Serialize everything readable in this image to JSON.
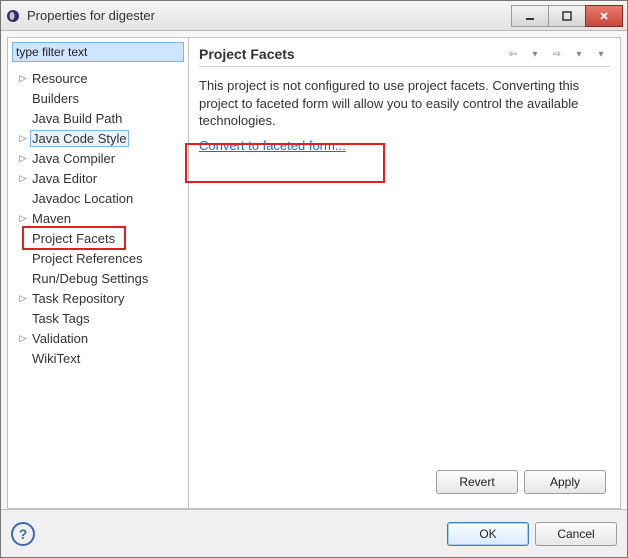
{
  "window": {
    "title": "Properties for digester"
  },
  "filter": {
    "placeholder": "type filter text"
  },
  "tree": {
    "items": [
      {
        "label": "Resource",
        "expandable": true
      },
      {
        "label": "Builders",
        "expandable": false
      },
      {
        "label": "Java Build Path",
        "expandable": false
      },
      {
        "label": "Java Code Style",
        "expandable": true,
        "selectedBlue": true
      },
      {
        "label": "Java Compiler",
        "expandable": true
      },
      {
        "label": "Java Editor",
        "expandable": true
      },
      {
        "label": "Javadoc Location",
        "expandable": false
      },
      {
        "label": "Maven",
        "expandable": true
      },
      {
        "label": "Project Facets",
        "expandable": false,
        "redbox": true
      },
      {
        "label": "Project References",
        "expandable": false
      },
      {
        "label": "Run/Debug Settings",
        "expandable": false
      },
      {
        "label": "Task Repository",
        "expandable": true
      },
      {
        "label": "Task Tags",
        "expandable": false
      },
      {
        "label": "Validation",
        "expandable": true
      },
      {
        "label": "WikiText",
        "expandable": false
      }
    ]
  },
  "main": {
    "title": "Project Facets",
    "description": "This project is not configured to use project facets. Converting this project to faceted form will allow you to easily control the available technologies.",
    "link": "Convert to faceted form..."
  },
  "buttons": {
    "revert": "Revert",
    "apply": "Apply",
    "ok": "OK",
    "cancel": "Cancel"
  },
  "icons": {
    "twisty": "▷"
  }
}
